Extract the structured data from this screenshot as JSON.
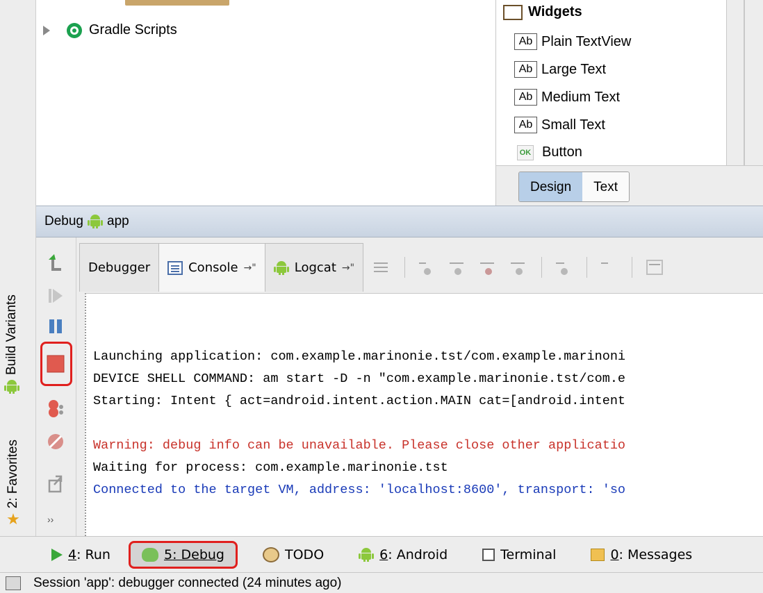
{
  "left_strip": {
    "build_variants": "Build Variants",
    "favorites": "2: Favorites"
  },
  "project_tree": {
    "gradle_scripts": "Gradle Scripts"
  },
  "palette": {
    "header": "Widgets",
    "items": [
      {
        "icon": "Ab",
        "label": "Plain TextView"
      },
      {
        "icon": "Ab",
        "label": "Large Text"
      },
      {
        "icon": "Ab",
        "label": "Medium Text"
      },
      {
        "icon": "Ab",
        "label": "Small Text"
      },
      {
        "icon": "OK",
        "label": "Button"
      }
    ],
    "tabs": [
      "Design",
      "Text"
    ],
    "active_tab": "Design"
  },
  "debug_panel": {
    "title_prefix": "Debug",
    "config": "app",
    "tabs": [
      {
        "label": "Debugger"
      },
      {
        "label": "Console",
        "pin": "→\""
      },
      {
        "label": "Logcat",
        "pin": "→\""
      }
    ],
    "active_tab": "Console"
  },
  "console": {
    "lines": [
      {
        "text": "Launching application: com.example.marinonie.tst/com.example.marinoni",
        "kind": "normal"
      },
      {
        "text": "DEVICE SHELL COMMAND: am start -D -n \"com.example.marinonie.tst/com.e",
        "kind": "normal"
      },
      {
        "text": "Starting: Intent { act=android.intent.action.MAIN cat=[android.intent",
        "kind": "normal"
      },
      {
        "text": "Warning: debug info can be unavailable. Please close other applicatio",
        "kind": "warn"
      },
      {
        "text": "Waiting for process: com.example.marinonie.tst",
        "kind": "normal"
      },
      {
        "text": "Connected to the target VM, address: 'localhost:8600', transport: 'so",
        "kind": "blue"
      }
    ]
  },
  "bottom_bar": {
    "run": {
      "key": "4",
      "label": ": Run"
    },
    "debug": {
      "key": "5",
      "label": ": Debug"
    },
    "todo": {
      "label": "TODO"
    },
    "android": {
      "key": "6",
      "label": ": Android"
    },
    "terminal": {
      "label": "Terminal"
    },
    "messages": {
      "key": "0",
      "label": ": Messages"
    }
  },
  "status_bar": {
    "text": "Session 'app': debugger connected (24 minutes ago)"
  },
  "colors": {
    "highlight_red": "#e0201e",
    "android_green": "#8cc83c",
    "warning_red": "#c8322a",
    "connected_blue": "#1a3bb8",
    "debug_header_blue": "#c9d4e2"
  }
}
